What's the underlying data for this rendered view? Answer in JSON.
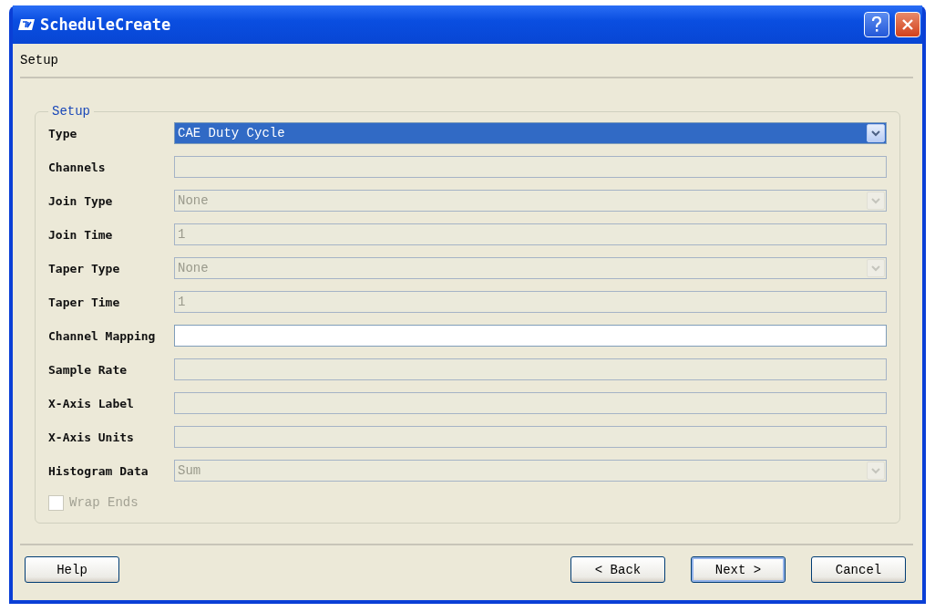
{
  "window": {
    "title": "ScheduleCreate"
  },
  "menu": [
    {
      "label": "Setup"
    }
  ],
  "group": {
    "title": "Setup",
    "fields": [
      {
        "label": "Type",
        "kind": "combo",
        "value": "CAE Duty Cycle",
        "disabled": false,
        "selected": true
      },
      {
        "label": "Channels",
        "kind": "text",
        "disabled": true,
        "selected": false
      },
      {
        "label": "Join Type",
        "kind": "combo",
        "value": "None",
        "disabled": true,
        "selected": false
      },
      {
        "label": "Join Time",
        "kind": "text",
        "value": "1",
        "disabled": true,
        "selected": false
      },
      {
        "label": "Taper Type",
        "kind": "combo",
        "value": "None",
        "disabled": true,
        "selected": false
      },
      {
        "label": "Taper Time",
        "kind": "text",
        "value": "1",
        "disabled": true,
        "selected": false
      },
      {
        "label": "Channel Mapping",
        "kind": "text",
        "disabled": false,
        "selected": false
      },
      {
        "label": "Sample Rate",
        "kind": "text",
        "disabled": true,
        "selected": false
      },
      {
        "label": "X-Axis Label",
        "kind": "text",
        "disabled": true,
        "selected": false
      },
      {
        "label": "X-Axis Units",
        "kind": "text",
        "disabled": true,
        "selected": false
      },
      {
        "label": "Histogram Data",
        "kind": "combo",
        "value": "Sum",
        "disabled": true,
        "selected": false
      }
    ],
    "checkbox": {
      "label": "Wrap Ends",
      "checked": false,
      "disabled": true
    }
  },
  "left_buttons": [
    {
      "label": "Help",
      "default": false
    }
  ],
  "right_buttons": [
    {
      "label": "< Back",
      "default": false
    },
    {
      "label": "Next >",
      "default": true
    },
    {
      "label": "Cancel",
      "default": false
    }
  ]
}
